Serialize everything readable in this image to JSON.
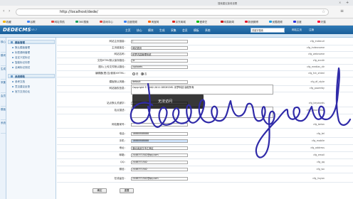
{
  "browser": {
    "tab_title": "搜索建议接收设置",
    "url": "http://localhost/dede/",
    "bookmarks": [
      {
        "label": "收藏",
        "color": "#f4b400"
      },
      {
        "label": "谷歌",
        "color": "#4285f4"
      },
      {
        "label": "网址导航",
        "color": "#e8453c"
      },
      {
        "label": "360搜索",
        "color": "#19a15f"
      },
      {
        "label": "游戏中心",
        "color": "#e8453c"
      },
      {
        "label": "百度视频",
        "color": "#3b82f6"
      },
      {
        "label": "淘宝网",
        "color": "#ff6600"
      },
      {
        "label": "京东商城",
        "color": "#e1251b"
      },
      {
        "label": "爱奇艺",
        "color": "#00be06"
      },
      {
        "label": "网易新闻",
        "color": "#cc0000"
      },
      {
        "label": "新浪微博",
        "color": "#e6162d"
      },
      {
        "label": "优酷视频",
        "color": "#1a9ee7"
      },
      {
        "label": "百度",
        "color": "#2932e1"
      },
      {
        "label": "天猫",
        "color": "#ff0036"
      }
    ]
  },
  "header": {
    "logo": "DEDECMS",
    "logo_sub": "V5.7",
    "nav": [
      "主页",
      "核心",
      "模块",
      "生成",
      "采集",
      "会员",
      "模板",
      "系统"
    ],
    "search_placeholder": "关键字搜索",
    "right_links": [
      "网站主页",
      "注销"
    ]
  },
  "sidebar_tabs": [
    "核心",
    "模块",
    "生成",
    "采集",
    "会员",
    "模板",
    "系统"
  ],
  "sidebar": {
    "groups": [
      {
        "title": "模板管理",
        "items": [
          "默认模板管理",
          "标签源码管理",
          "自定义宏标记",
          "智能标记向导",
          "全局标记测试"
        ]
      },
      {
        "title": "系统帮助",
        "items": [
          "参考文档",
          "意见建议反馈",
          "官方交流论坛"
        ]
      }
    ]
  },
  "form": {
    "rows": [
      {
        "label": "网站主页链接：",
        "value": "/",
        "var": "cfg_indexurl"
      },
      {
        "label": "主页链接名：",
        "value": "网站首页",
        "var": "cfg_indexname"
      },
      {
        "label": "网站名称：",
        "value": "织梦内容管理系统",
        "var": "cfg_webname"
      },
      {
        "label": "文档HTML默认保存路径：",
        "value": "/a",
        "var": "cfg_arcdir"
      },
      {
        "label": "图片/上传文件默认路径：",
        "value": "/uploads",
        "var": "cfg_medias_dir"
      },
      {
        "label": "编辑器(是/否)使用XHTML：",
        "value": "",
        "var": "cfg_fck_xhtml"
      },
      {
        "label": "模板默认风格：",
        "value": "default",
        "var": "cfg_df_style"
      },
      {
        "label": "网站版权信息：",
        "value": "Copyright © 2002-2011 DEDECMS. 织梦科技 版权所有",
        "var": "cfg_powerby"
      },
      {
        "label": "站点默认关键字：",
        "value": "",
        "var": "cfg_keywords"
      },
      {
        "label": "站点描述：",
        "value": "",
        "var": "cfg_description"
      },
      {
        "label": "网站备案号：",
        "value": "",
        "var": "cfg_beian"
      },
      {
        "label": "电话：",
        "value": "18888888888",
        "var": "cfg_tel"
      },
      {
        "label": "手机：",
        "value": "18888888888",
        "var": "cfg_mobile"
      },
      {
        "label": "地址：",
        "value": "湖北省武汉市江岸区",
        "var": "cfg_address"
      },
      {
        "label": "邮箱：",
        "value": "2448371502@qq.com",
        "var": "cfg_email"
      },
      {
        "label": "QQ：",
        "value": "2448371502",
        "var": "cfg_qq"
      },
      {
        "label": "微信：",
        "value": "2448371502",
        "var": "cfg_wx"
      },
      {
        "label": "在线留言：",
        "value": "2448371502@qq.com",
        "var": "cfg_liuyan"
      }
    ],
    "radio_options": [
      "是",
      "否"
    ],
    "radio_selected": "否"
  },
  "toast": {
    "text": "无法访问"
  },
  "buttons": {
    "submit": "确定",
    "reset": "重置"
  },
  "overlay": {
    "signature_text": "deeborgoud",
    "signature_color": "#2f2aa8"
  }
}
